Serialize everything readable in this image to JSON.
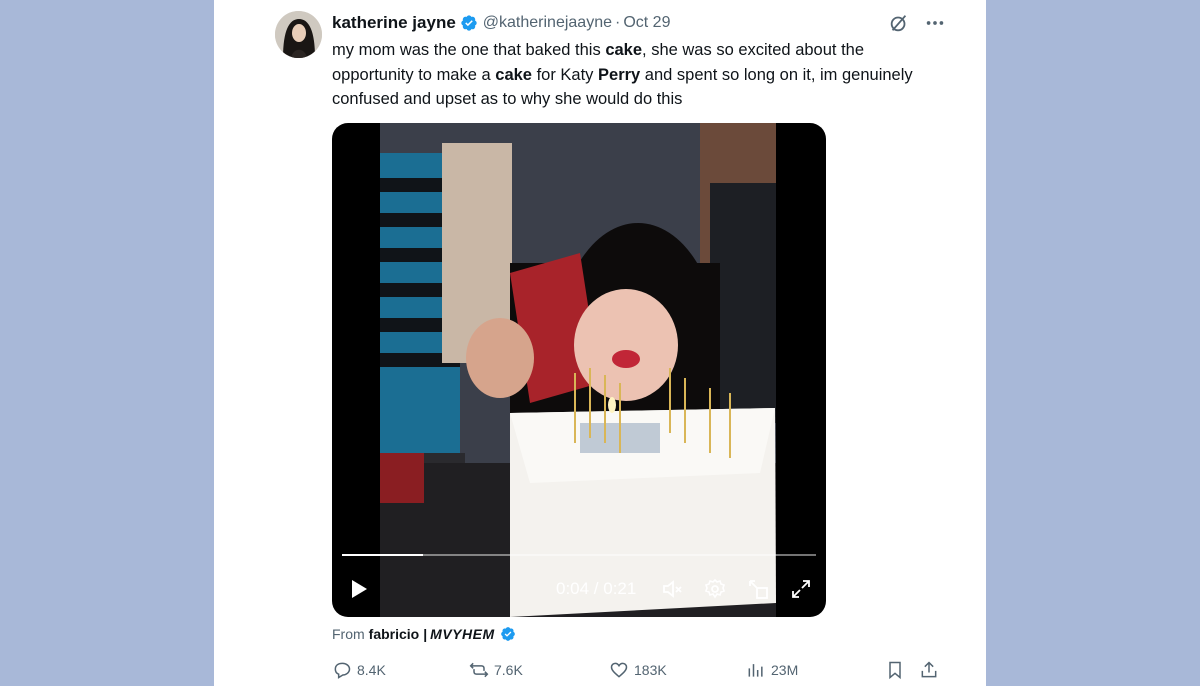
{
  "tweet": {
    "display_name": "katherine jayne",
    "handle": "@katherinejaayne",
    "separator": "·",
    "date": "Oct 29",
    "text_parts": [
      "my mom was the one that baked this ",
      "cake",
      ", she was so excited about the opportunity to make a ",
      "cake",
      " for Katy ",
      "Perry",
      " and spent so long on it, im genuinely confused and upset as to why she would do this"
    ]
  },
  "video": {
    "time": "0:04 / 0:21",
    "progress": 0.17
  },
  "source": {
    "prefix": "From",
    "name": "fabricio",
    "divider": "|",
    "brand": "MVYHEM"
  },
  "actions": {
    "replies": "8.4K",
    "reposts": "7.6K",
    "likes": "183K",
    "views": "23M"
  },
  "colors": {
    "verified": "#1d9bf0",
    "muted": "#536471",
    "background": "#a8b8d8"
  },
  "icons": [
    "verified-badge-icon",
    "grok-icon",
    "more-icon",
    "play-icon",
    "mute-icon",
    "settings-icon",
    "pip-icon",
    "fullscreen-icon",
    "reply-icon",
    "repost-icon",
    "like-icon",
    "views-icon",
    "bookmark-icon",
    "share-icon"
  ]
}
